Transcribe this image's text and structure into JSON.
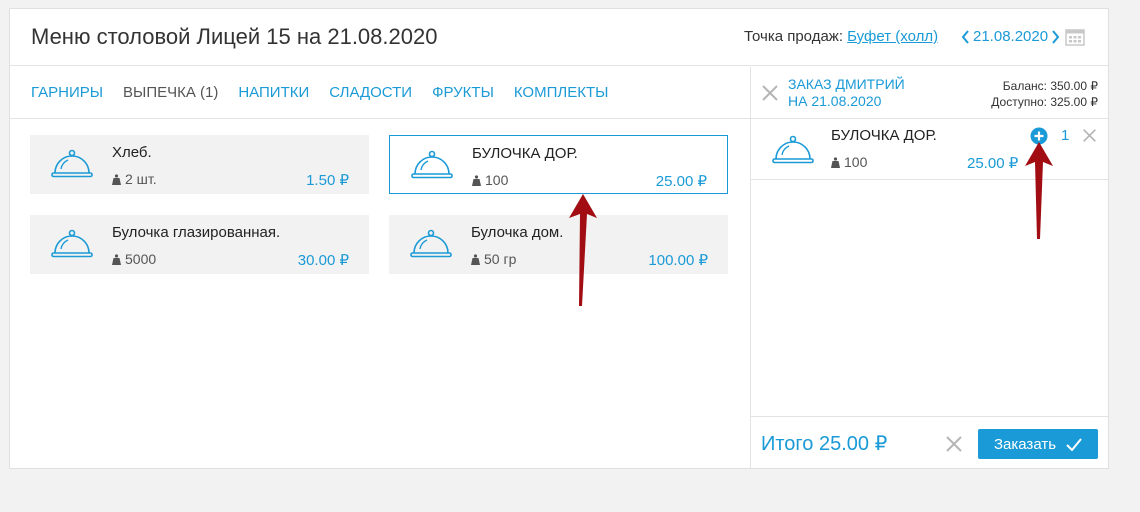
{
  "header": {
    "title": "Меню столовой Лицей 15 на 21.08.2020",
    "pos_label": "Точка продаж:",
    "pos_value": "Буфет (холл)",
    "date": "21.08.2020"
  },
  "tabs": [
    {
      "label": "ГАРНИРЫ",
      "active": false
    },
    {
      "label": "ВЫПЕЧКА (1)",
      "active": true
    },
    {
      "label": "НАПИТКИ",
      "active": false
    },
    {
      "label": "СЛАДОСТИ",
      "active": false
    },
    {
      "label": "ФРУКТЫ",
      "active": false
    },
    {
      "label": "КОМПЛЕКТЫ",
      "active": false
    }
  ],
  "menu_items": [
    {
      "name": "Хлеб.",
      "weight": "2 шт.",
      "price": "1.50 ₽",
      "selected": false
    },
    {
      "name": "БУЛОЧКА ДОР.",
      "weight": "100",
      "price": "25.00 ₽",
      "selected": true
    },
    {
      "name": "Булочка глазированная.",
      "weight": "5000",
      "price": "30.00 ₽",
      "selected": false
    },
    {
      "name": "Булочка дом.",
      "weight": "50 гр",
      "price": "100.00 ₽",
      "selected": false
    }
  ],
  "order": {
    "title_line1": "ЗАКАЗ ДМИТРИЙ",
    "title_line2": "НА 21.08.2020",
    "balance": "Баланс: 350.00 ₽",
    "available": "Доступно: 325.00 ₽",
    "items": [
      {
        "name": "БУЛОЧКА ДОР.",
        "weight": "100",
        "price": "25.00 ₽",
        "qty": "1"
      }
    ],
    "total": "Итого 25.00 ₽",
    "submit_label": "Заказать"
  },
  "colors": {
    "accent": "#1a9ad6",
    "arrow": "#a10d12",
    "card_bg": "#f2f2f2"
  }
}
